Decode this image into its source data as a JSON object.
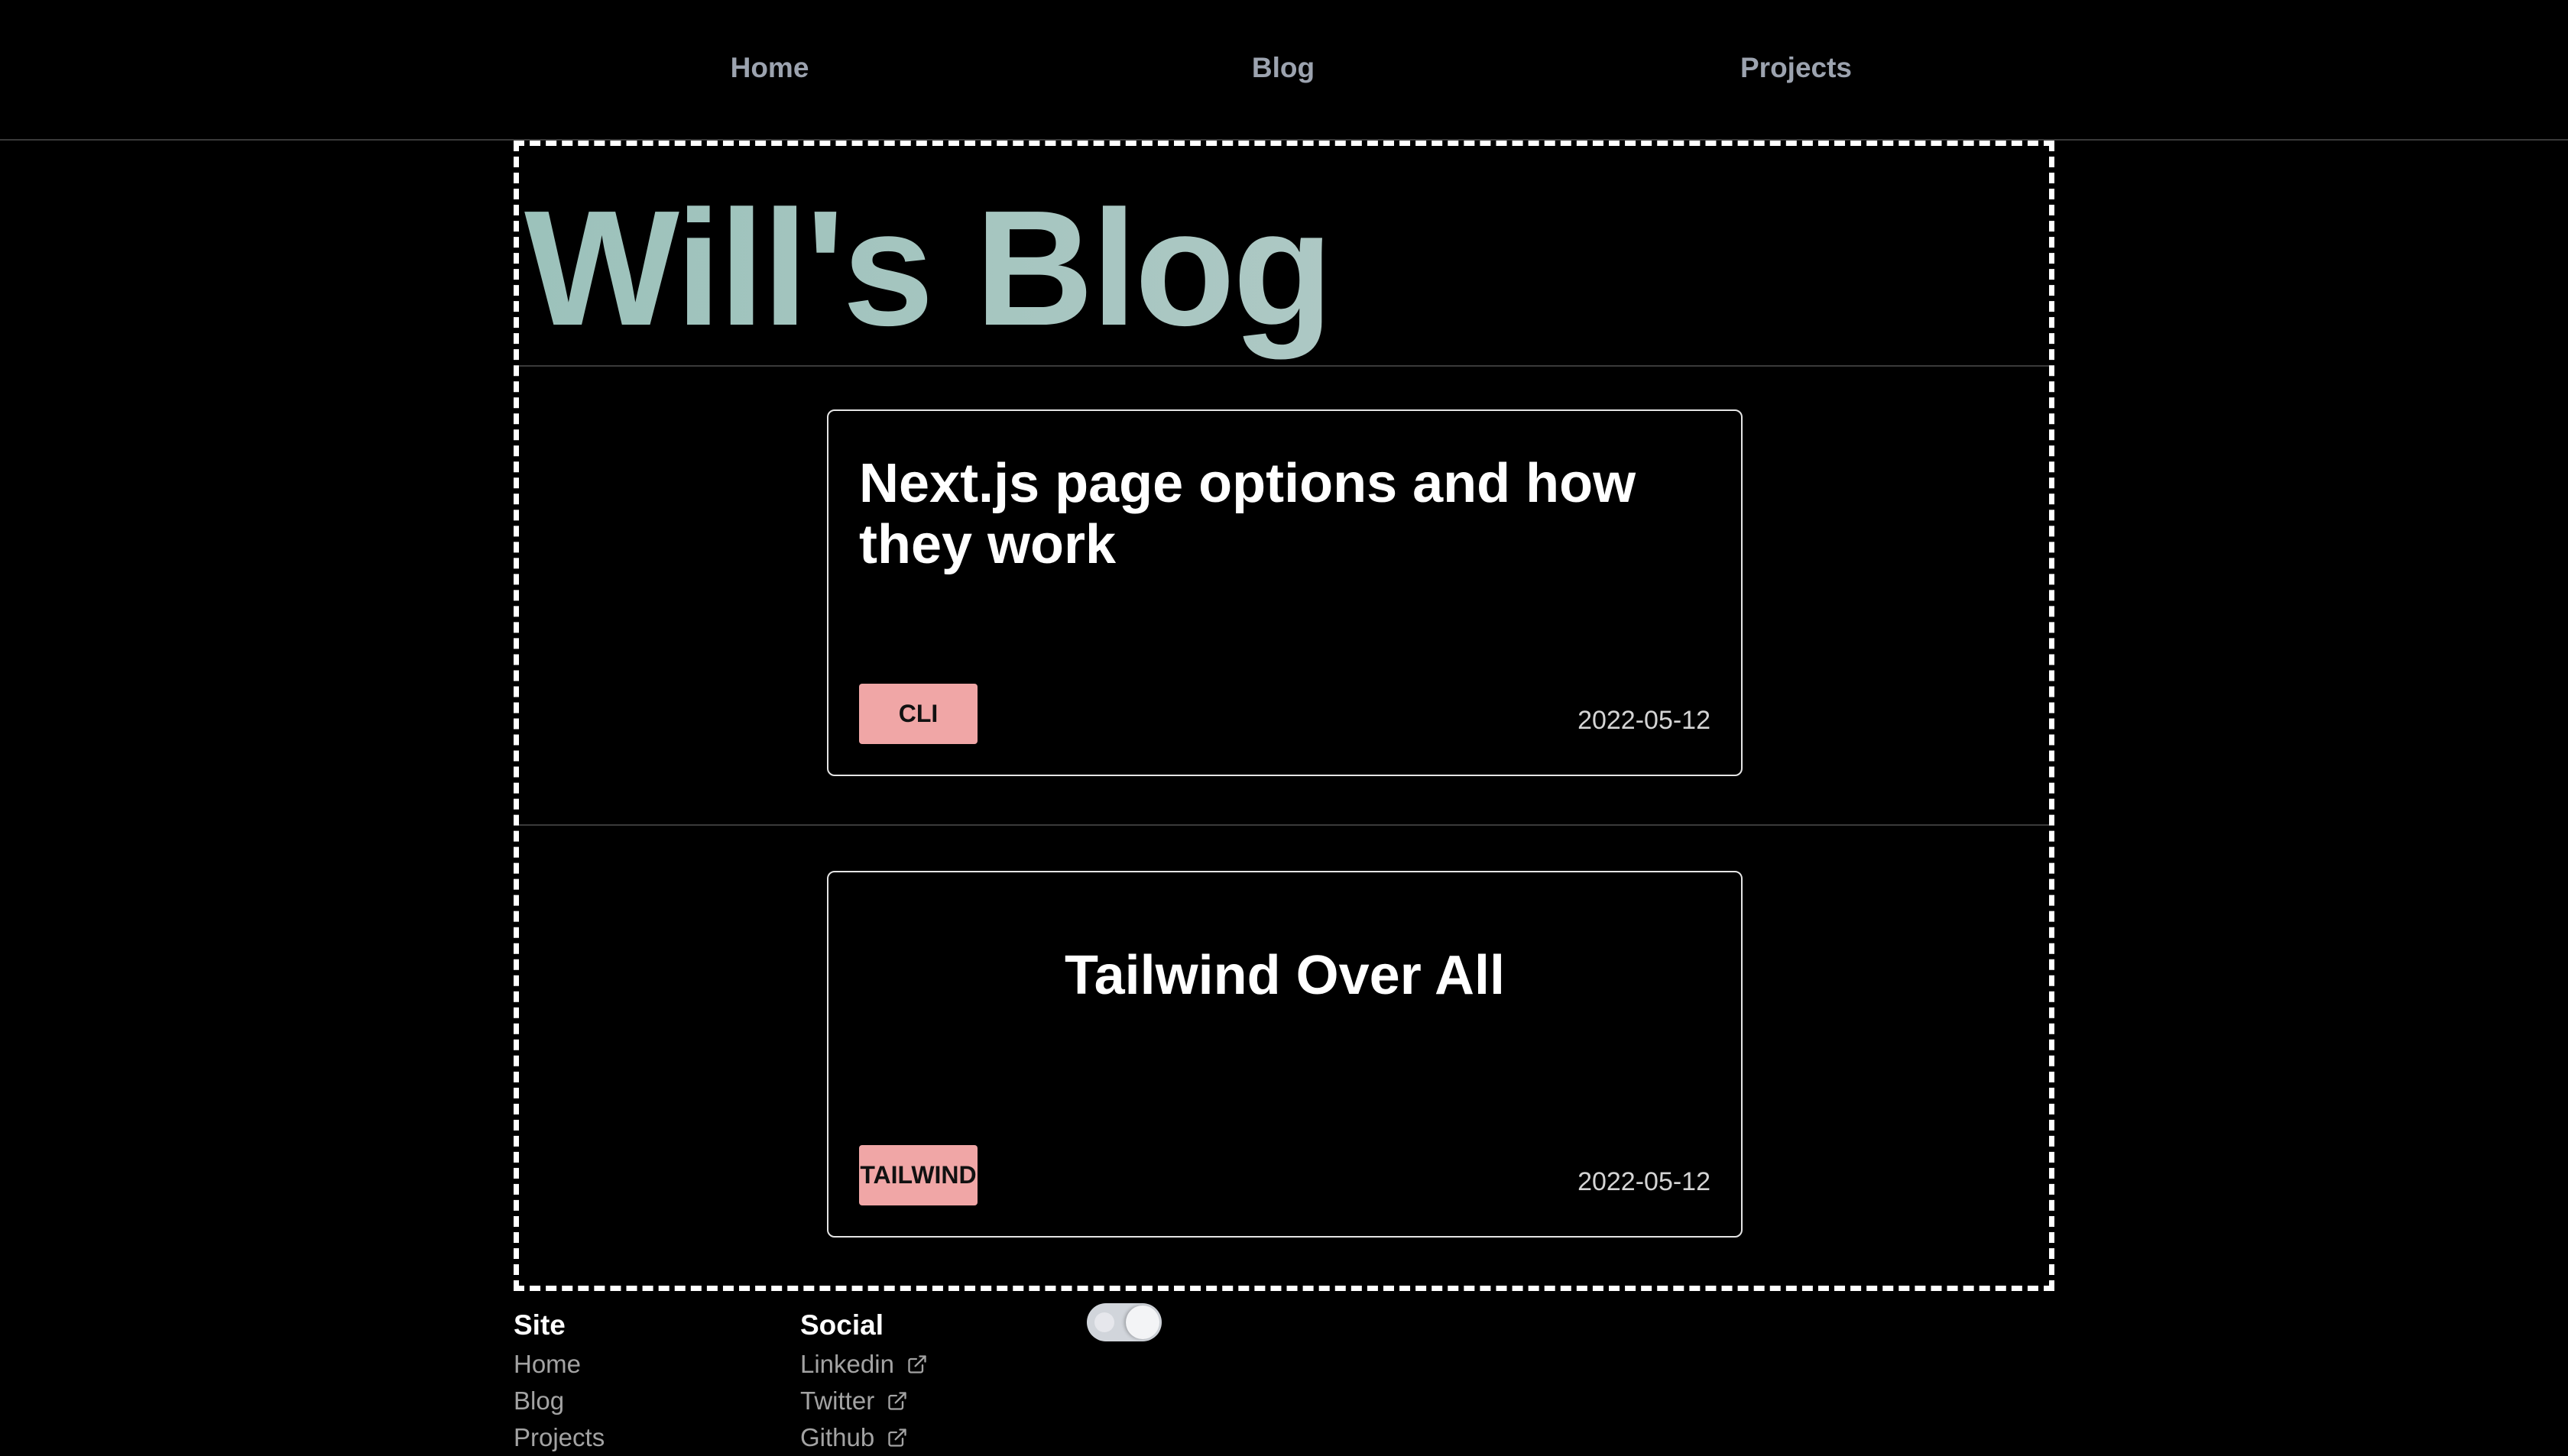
{
  "nav": {
    "home": "Home",
    "blog": "Blog",
    "projects": "Projects"
  },
  "main": {
    "title": "Will's Blog",
    "posts": [
      {
        "title": "Next.js page options and how they work",
        "tag": "CLI",
        "date": "2022-05-12",
        "title_align": "left"
      },
      {
        "title": "Tailwind Over All",
        "tag": "TAILWIND",
        "date": "2022-05-12",
        "title_align": "center"
      }
    ]
  },
  "footer": {
    "site": {
      "heading": "Site",
      "links": [
        "Home",
        "Blog",
        "Projects"
      ]
    },
    "social": {
      "heading": "Social",
      "links": [
        "Linkedin",
        "Twitter",
        "Github"
      ],
      "link_icon": "external-link-icon"
    },
    "theme_toggle": {
      "icon": "theme-toggle-icon",
      "state": "dark"
    }
  },
  "colors": {
    "background": "#000000",
    "title_gradient_start": "#9cc2bb",
    "title_gradient_end": "#adc8c4",
    "tag_background": "#f0a6a6",
    "nav_text": "#9ca3af"
  }
}
